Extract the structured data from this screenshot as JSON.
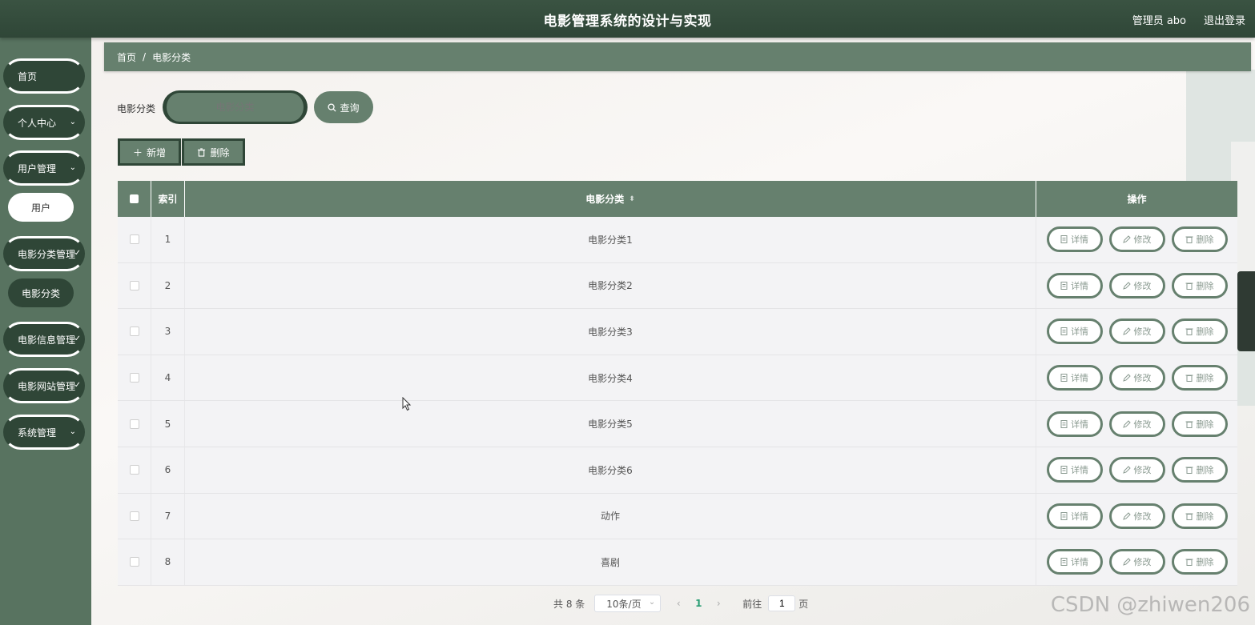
{
  "header": {
    "title": "电影管理系统的设计与实现",
    "user": "管理员 abo",
    "logout": "退出登录"
  },
  "sidebar": {
    "items": [
      {
        "label": "首页"
      },
      {
        "label": "个人中心",
        "chevron": "⌄"
      },
      {
        "label": "用户管理",
        "chevron": "⌄"
      },
      {
        "label": "用户"
      },
      {
        "label": "电影分类管理",
        "chevron": "✓"
      },
      {
        "label": "电影分类"
      },
      {
        "label": "电影信息管理",
        "chevron": "✓"
      },
      {
        "label": "电影网站管理",
        "chevron": "✓"
      },
      {
        "label": "系统管理",
        "chevron": "⌄"
      }
    ]
  },
  "breadcrumb": {
    "home": "首页",
    "sep": "/",
    "current": "电影分类"
  },
  "search": {
    "label": "电影分类",
    "placeholder": "电影分类",
    "button": "查询",
    "button_icon": "search-icon"
  },
  "toolbar": {
    "add": "新增",
    "delete": "删除"
  },
  "table": {
    "headers": {
      "index": "索引",
      "name": "电影分类",
      "sort_icon": "⬍",
      "ops": "操作"
    },
    "rows": [
      {
        "index": "1",
        "name": "电影分类1"
      },
      {
        "index": "2",
        "name": "电影分类2"
      },
      {
        "index": "3",
        "name": "电影分类3"
      },
      {
        "index": "4",
        "name": "电影分类4"
      },
      {
        "index": "5",
        "name": "电影分类5"
      },
      {
        "index": "6",
        "name": "电影分类6"
      },
      {
        "index": "7",
        "name": "动作"
      },
      {
        "index": "8",
        "name": "喜剧"
      }
    ],
    "ops": {
      "detail": "详情",
      "edit": "修改",
      "delete": "删除"
    }
  },
  "pagination": {
    "total": "共 8 条",
    "page_size": "10条/页",
    "prev": "‹",
    "current_page": "1",
    "next": "›",
    "goto_label": "前往",
    "goto_value": "1",
    "page_unit": "页"
  },
  "watermark": "CSDN @zhiwen206",
  "colors": {
    "header": "#2f4637",
    "accent": "#66806e",
    "sidebar": "#587360"
  }
}
